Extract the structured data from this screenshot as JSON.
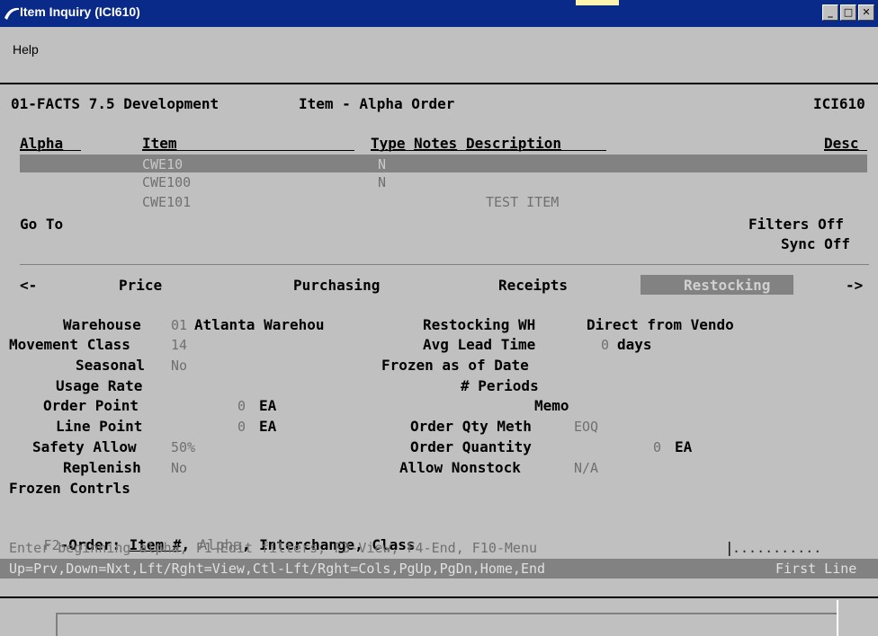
{
  "window": {
    "title": "Item Inquiry (ICI610)",
    "menu_help": "Help"
  },
  "header": {
    "company": "01-FACTS 7.5 Development",
    "view": "Item - Alpha Order",
    "program": "ICI610"
  },
  "columns": {
    "alpha": "Alpha",
    "item": "Item",
    "type": "Type",
    "notes": "Notes",
    "description": "Description",
    "desc": "Desc"
  },
  "rows": [
    {
      "item": "CWE10",
      "type": "N",
      "description": ""
    },
    {
      "item": "CWE100",
      "type": "N",
      "description": ""
    },
    {
      "item": "CWE101",
      "type": "",
      "description": "TEST ITEM"
    }
  ],
  "goto_label": "Go To",
  "filters": "Filters Off",
  "sync": "Sync Off",
  "tabs": {
    "prev": "<-",
    "price": "Price",
    "purchasing": "Purchasing",
    "receipts": "Receipts",
    "restocking": "Restocking",
    "next": "->"
  },
  "fields": {
    "warehouse_label": "Warehouse",
    "warehouse_code": "01",
    "warehouse_name": "Atlanta Warehou",
    "restocking_wh_label": "Restocking WH",
    "restocking_wh_value": "Direct from Vendo",
    "movement_class_label": "Movement Class",
    "movement_class_value": "14",
    "avg_lead_time_label": "Avg Lead Time",
    "avg_lead_time_value": "0",
    "avg_lead_time_unit": "days",
    "seasonal_label": "Seasonal",
    "seasonal_value": "No",
    "frozen_as_of_label": "Frozen as of Date",
    "usage_rate_label": "Usage Rate",
    "periods_label": "# Periods",
    "order_point_label": "Order Point",
    "order_point_value": "0",
    "order_point_unit": "EA",
    "memo_label": "Memo",
    "line_point_label": "Line Point",
    "line_point_value": "0",
    "line_point_unit": "EA",
    "order_qty_meth_label": "Order Qty Meth",
    "order_qty_meth_value": "EOQ",
    "safety_allow_label": "Safety Allow",
    "safety_allow_value": "50%",
    "order_quantity_label": "Order Quantity",
    "order_quantity_value": "0",
    "order_quantity_unit": "EA",
    "replenish_label": "Replenish",
    "replenish_value": "No",
    "allow_nonstock_label": "Allow Nonstock",
    "allow_nonstock_value": "N/A",
    "frozen_controls_label": "Frozen Contrls"
  },
  "prompt": {
    "key": "F2",
    "order_text": "-Order: ",
    "item": "Item #",
    "sep1": ", ",
    "alpha": "Alpha",
    "sep2": ", ",
    "interchange": "Interchange",
    "sep3": ", ",
    "class": "Class",
    "help_line": "Enter beginning alpha, F1-Edit filters, F3-View, F4-End, F10-Menu",
    "input_value": "...........",
    "status_line": "Up=Prv,Down=Nxt,Lft/Rght=View,Ctl-Lft/Rght=Cols,PgUp,PgDn,Home,End",
    "status_right": "First Line"
  },
  "colors": {
    "titlebar": "#0a2a8a",
    "highlight": "#828282",
    "background": "#c0c0c0"
  }
}
